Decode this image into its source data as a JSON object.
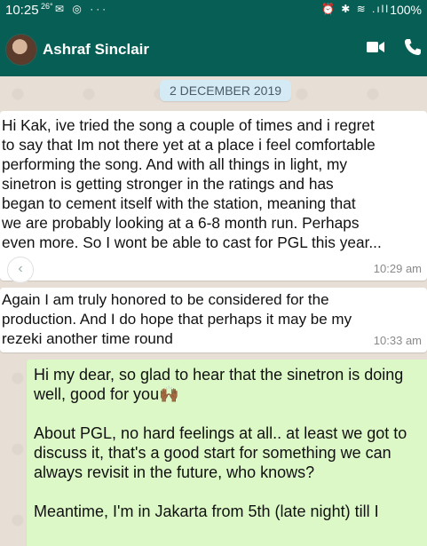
{
  "status_bar": {
    "time": "10:25",
    "temp": "26°",
    "left_icons": "✉ ◎ ···",
    "right_icons": "⏰ ✱ ≋ .ıll",
    "battery": "100%"
  },
  "header": {
    "contact_name": "Ashraf Sinclair",
    "video_icon": "video-call-icon",
    "phone_icon": "voice-call-icon",
    "color": "#075e54"
  },
  "chat": {
    "date_chip": "2 DECEMBER 2019",
    "messages": [
      {
        "direction": "incoming",
        "text": "Hi Kak, ive tried the song a couple of times and i regret\nto say that Im not there yet at a place i feel comfortable\nperforming the song. And with all things in light, my\nsinetron is getting stronger in the ratings and has\nbegan to cement itself with the station, meaning that\nwe are probably looking at a 6-8 month run. Perhaps\neven more.  So I wont be able to cast for PGL this year...",
        "time": "10:29 am"
      },
      {
        "direction": "incoming",
        "text": "Again I am truly honored to be considered for the\nproduction. And I do hope that perhaps it may be my\nrezeki another time round",
        "time": "10:33 am"
      },
      {
        "direction": "outgoing",
        "text_part1": "Hi my dear, so glad to hear that the sinetron is doing\nwell, good for you",
        "emoji": "🙌🏾",
        "text_part2": "\n\nAbout PGL, no hard feelings at all.. at least we got to\ndiscuss it, that's a good start for something we can\nalways revisit in the future, who knows?\n\nMeantime, I'm in Jakarta from 5th (late night) till I",
        "bubble_color": "#dcf8c6"
      }
    ]
  }
}
